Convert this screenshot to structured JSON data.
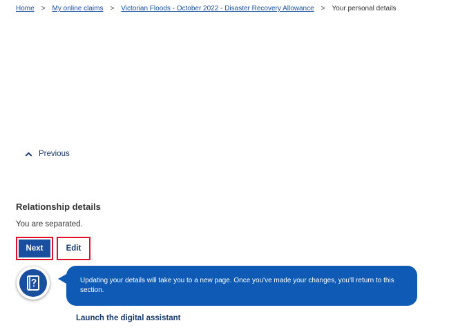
{
  "breadcrumb": {
    "items": [
      {
        "label": "Home"
      },
      {
        "label": "My online claims"
      },
      {
        "label": "Victorian Floods - October 2022 - Disaster Recovery Allowance"
      }
    ],
    "separator": ">",
    "current": "Your personal details"
  },
  "navigation": {
    "previous_label": "Previous"
  },
  "section": {
    "title": "Relationship details",
    "text": "You are separated."
  },
  "actions": {
    "next_label": "Next",
    "edit_label": "Edit"
  },
  "assistant": {
    "message": "Updating your details will take you to a new page. Once you've made your changes, you'll return to this section.",
    "launch_label": "Launch the digital assistant",
    "icon": "help-book-icon"
  },
  "colors": {
    "primary": "#1a4fa0",
    "bubble": "#0e5ab4",
    "highlight": "#e0102a",
    "link_dark": "#1a3a6e"
  }
}
